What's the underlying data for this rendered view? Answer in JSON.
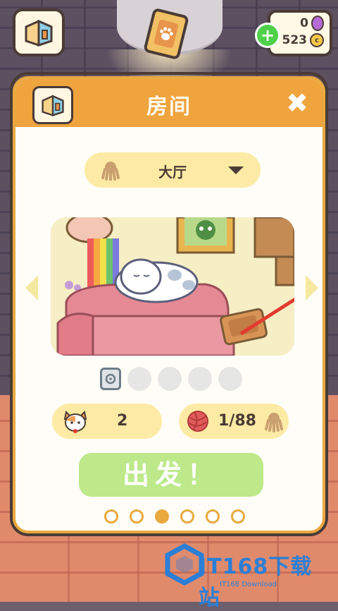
{
  "hud": {
    "gems": "0",
    "coins": "523",
    "coin_symbol": "c",
    "add_label": "+"
  },
  "dialog": {
    "title": "房间",
    "close_symbol": "✖"
  },
  "room_selector": {
    "selected": "大厅"
  },
  "stats": {
    "cats": "2",
    "yarn": "1/88"
  },
  "go_button": {
    "label": "出发！"
  },
  "pager": {
    "count": 6,
    "active_index": 2
  },
  "watermark": {
    "main": "IT168下载站",
    "sub": "IT168 Download"
  },
  "colors": {
    "header": "#efa43e",
    "go_button": "#bde98a",
    "pill": "#fdeaa4"
  }
}
